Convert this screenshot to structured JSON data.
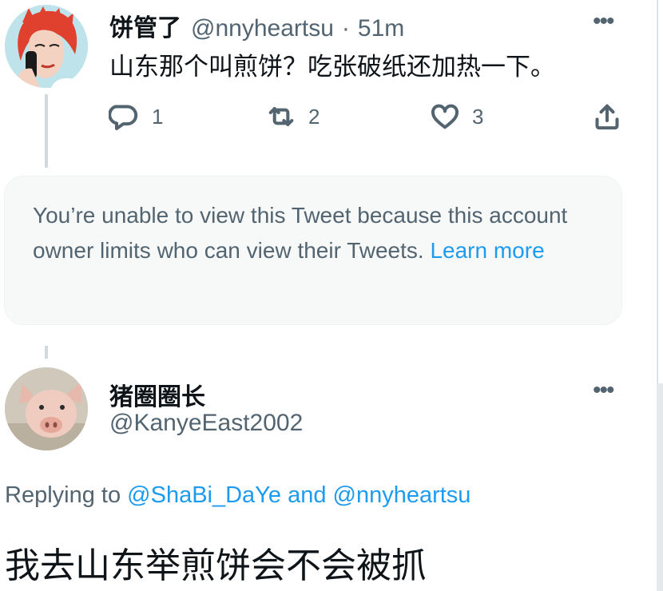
{
  "tweet1": {
    "name": "饼管了",
    "handle": "@nnyheartsu",
    "separator": "·",
    "time": "51m",
    "text": "山东那个叫煎饼？吃张破纸还加热一下。",
    "reply_count": "1",
    "retweet_count": "2",
    "like_count": "3"
  },
  "restricted": {
    "message": "You’re unable to view this Tweet because this account owner limits who can view their Tweets.",
    "link": "Learn more"
  },
  "tweet2": {
    "name": "猪圈圈长",
    "handle": "@KanyeEast2002",
    "replying_prefix": "Replying to",
    "reply_user1": "@ShaBi_DaYe",
    "reply_and": "and",
    "reply_user2": "@nnyheartsu",
    "text": "我去山东举煎饼会不会被抓"
  },
  "icons": {
    "reply": "reply-icon",
    "retweet": "retweet-icon",
    "like": "heart-icon",
    "share": "share-icon",
    "more": "more-icon"
  },
  "colors": {
    "text": "#0f1419",
    "secondary": "#536471",
    "link": "#1d9bf0",
    "border": "#eff3f4",
    "card_bg": "#f7f9f9",
    "thread_line": "#cfd9de"
  }
}
